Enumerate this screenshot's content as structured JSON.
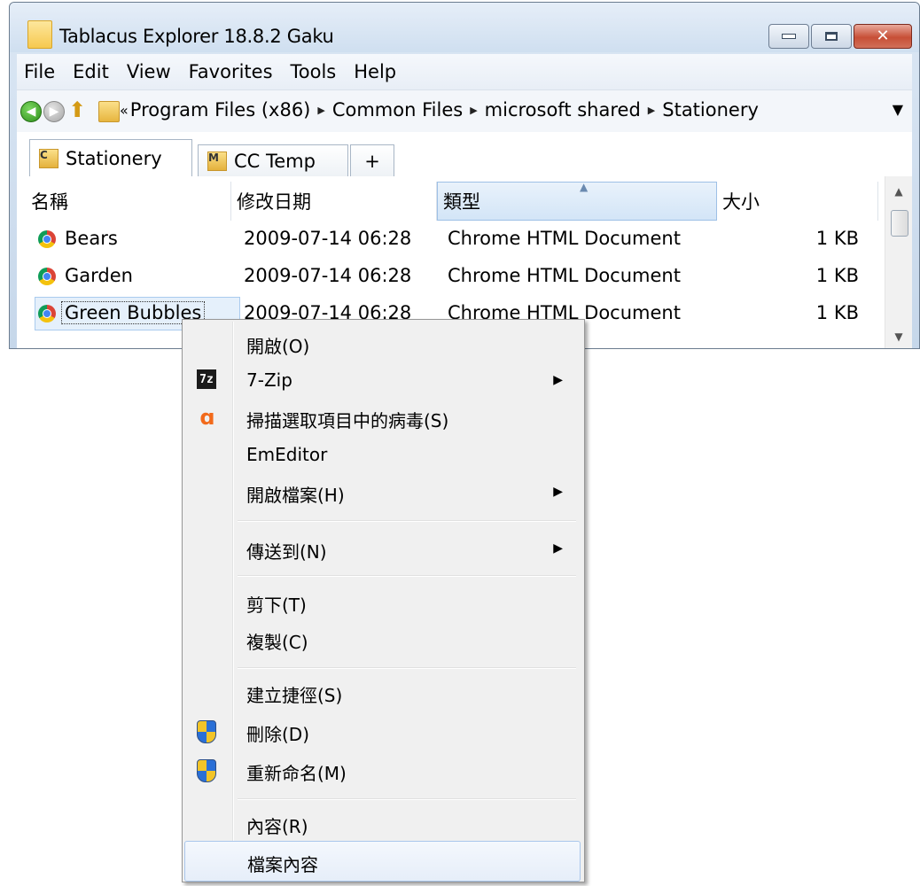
{
  "window": {
    "title": "Tablacus Explorer 18.8.2 Gaku",
    "close_glyph": "✕"
  },
  "menubar": {
    "items": [
      "File",
      "Edit",
      "View",
      "Favorites",
      "Tools",
      "Help"
    ]
  },
  "address": {
    "overflow": "«",
    "crumbs": [
      "Program Files (x86)",
      "Common Files",
      "microsoft shared",
      "Stationery"
    ],
    "separator": "▶",
    "dropdown": "▼"
  },
  "tabs": [
    {
      "label": "Stationery",
      "icon_letter": "C",
      "active": true
    },
    {
      "label": "CC Temp",
      "icon_letter": "M",
      "active": false
    }
  ],
  "new_tab": "+",
  "columns": [
    "名稱",
    "修改日期",
    "類型",
    "大小"
  ],
  "sort_indicator": "▲",
  "files": [
    {
      "name": "Bears",
      "date": "2009-07-14 06:28",
      "type": "Chrome HTML Document",
      "size": "1 KB"
    },
    {
      "name": "Garden",
      "date": "2009-07-14 06:28",
      "type": "Chrome HTML Document",
      "size": "1 KB"
    },
    {
      "name": "Green Bubbles",
      "date": "2009-07-14 06:28",
      "type": "Chrome HTML Document",
      "size": "1 KB"
    }
  ],
  "context_menu": {
    "items": [
      {
        "label": "開啟(O)"
      },
      {
        "label": "7-Zip",
        "submenu": "▶",
        "icon": "7zip-icon",
        "icon_text": "7z"
      },
      {
        "label": "掃描選取項目中的病毒(S)",
        "icon": "avast-icon",
        "icon_text": "ɑ"
      },
      {
        "label": "EmEditor"
      },
      {
        "label": "開啟檔案(H)",
        "submenu": "▶"
      },
      {
        "label": "傳送到(N)",
        "submenu": "▶"
      },
      {
        "label": "剪下(T)"
      },
      {
        "label": "複製(C)"
      },
      {
        "label": "建立捷徑(S)"
      },
      {
        "label": "刪除(D)",
        "icon": "uac-shield-icon"
      },
      {
        "label": "重新命名(M)",
        "icon": "uac-shield-icon"
      },
      {
        "label": "內容(R)"
      },
      {
        "label": "檔案內容"
      }
    ]
  },
  "colors": {
    "selection": "#e5f0fb",
    "menu_background": "#f0f0f0",
    "close_button": "#c74f36"
  }
}
